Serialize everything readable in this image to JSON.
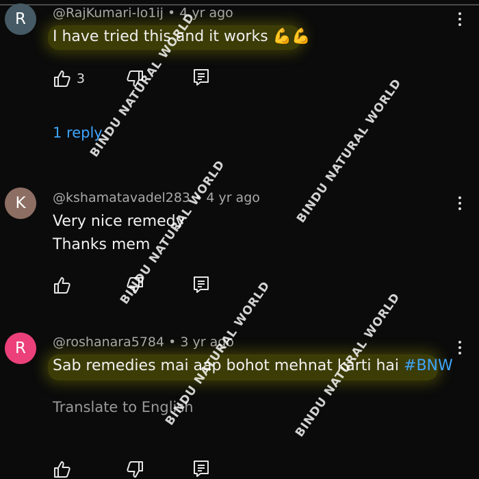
{
  "comments": [
    {
      "avatar_letter": "R",
      "avatar_color": "#455a64",
      "author": "@RajKumari-lo1ij",
      "separator": "•",
      "time": "4 yr ago",
      "text_lines": [
        "I have tried this and it works 💪💪"
      ],
      "like_count": "3",
      "reply_link": "1 reply"
    },
    {
      "avatar_letter": "K",
      "avatar_color": "#8d6e63",
      "author": "@kshamatavadel283",
      "separator": "•",
      "time": "4 yr ago",
      "text_lines": [
        "Very nice remedy",
        "Thanks mem"
      ]
    },
    {
      "avatar_letter": "R",
      "avatar_color": "#ec407a",
      "author": "@roshanara5784",
      "separator": "•",
      "time": "3 yr ago",
      "text_main": "Sab remedies mai aap bohot mehnat karti hai ",
      "hashtag": "#BNW",
      "translate_label": "Translate to English"
    }
  ],
  "watermark_text": "BINDU NATURAL WORLD",
  "colors": {
    "background": "#0b0b0b",
    "link_blue": "#3ea6ff",
    "highlight": "#787800"
  }
}
